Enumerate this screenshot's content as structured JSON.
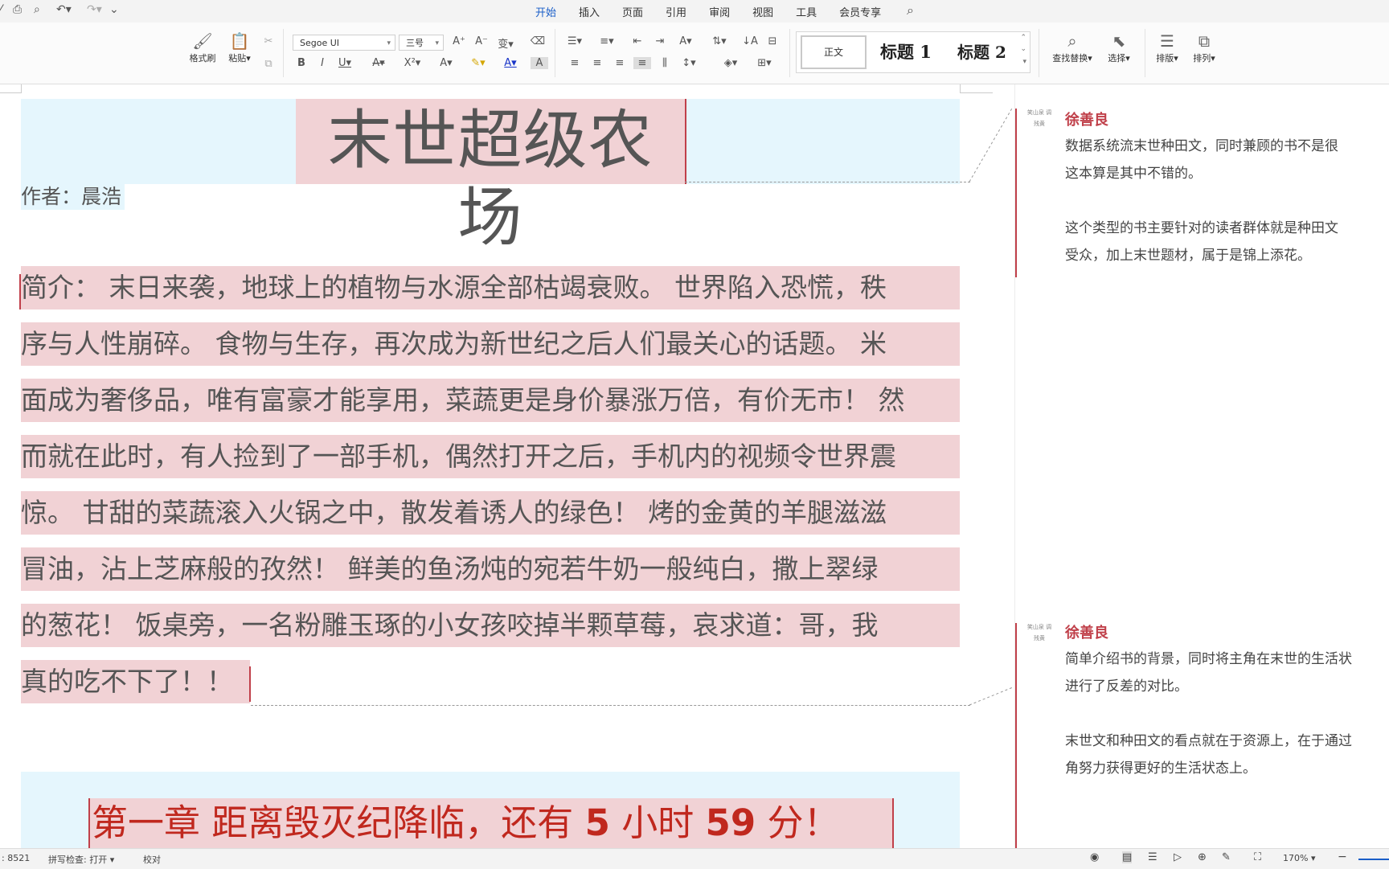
{
  "tabs": [
    {
      "label": "开始",
      "active": true
    },
    {
      "label": "插入"
    },
    {
      "label": "页面"
    },
    {
      "label": "引用"
    },
    {
      "label": "审阅"
    },
    {
      "label": "视图"
    },
    {
      "label": "工具"
    },
    {
      "label": "会员专享"
    }
  ],
  "ribbon": {
    "format_painter": "格式刷",
    "paste": "粘贴",
    "font_name": "Segoe UI",
    "font_size": "三号",
    "style_normal": "正文",
    "style_h1": "标题 1",
    "style_h2": "标题 2",
    "find_replace": "查找替换",
    "select": "选择",
    "layout": "排版",
    "arrange": "排列"
  },
  "document": {
    "title": "末世超级农场",
    "author": "作者：晨浩",
    "intro_lines": [
      "简介： 末日来袭，地球上的植物与水源全部枯竭衰败。 世界陷入恐慌，秩",
      "序与人性崩碎。 食物与生存，再次成为新世纪之后人们最关心的话题。 米",
      "面成为奢侈品，唯有富豪才能享用，菜蔬更是身价暴涨万倍，有价无市！ 然",
      "而就在此时，有人捡到了一部手机，偶然打开之后，手机内的视频令世界震",
      "惊。 甘甜的菜蔬滚入火锅之中，散发着诱人的绿色！ 烤的金黄的羊腿滋滋",
      "冒油，沾上芝麻般的孜然！ 鲜美的鱼汤炖的宛若牛奶一般纯白，撒上翠绿",
      "的葱花！ 饭桌旁，一名粉雕玉琢的小女孩咬掉半颗草莓，哀求道：哥，我",
      "真的吃不下了！！"
    ],
    "chapter": {
      "part1": "第一章  距离毁灭纪降临，还有 ",
      "num1": "5",
      "part2": " 小时 ",
      "num2": "59",
      "part3": " 分！"
    }
  },
  "comments": [
    {
      "author": "徐善良",
      "avatar": "笑山泉 调残黄",
      "lines": [
        "数据系统流末世种田文，同时兼顾的书不是很",
        "这本算是其中不错的。",
        "",
        "这个类型的书主要针对的读者群体就是种田文",
        "受众，加上末世题材，属于是锦上添花。"
      ]
    },
    {
      "author": "徐善良",
      "avatar": "笑山泉 调残黄",
      "lines": [
        "简单介绍书的背景，同时将主角在末世的生活状",
        "进行了反差的对比。",
        "",
        "末世文和种田文的看点就在于资源上，在于通过",
        "角努力获得更好的生活状态上。"
      ]
    }
  ],
  "status": {
    "word_count": ": 8521",
    "spell_check": "拼写检查: 打开",
    "proofread": "校对",
    "zoom": "170%"
  }
}
